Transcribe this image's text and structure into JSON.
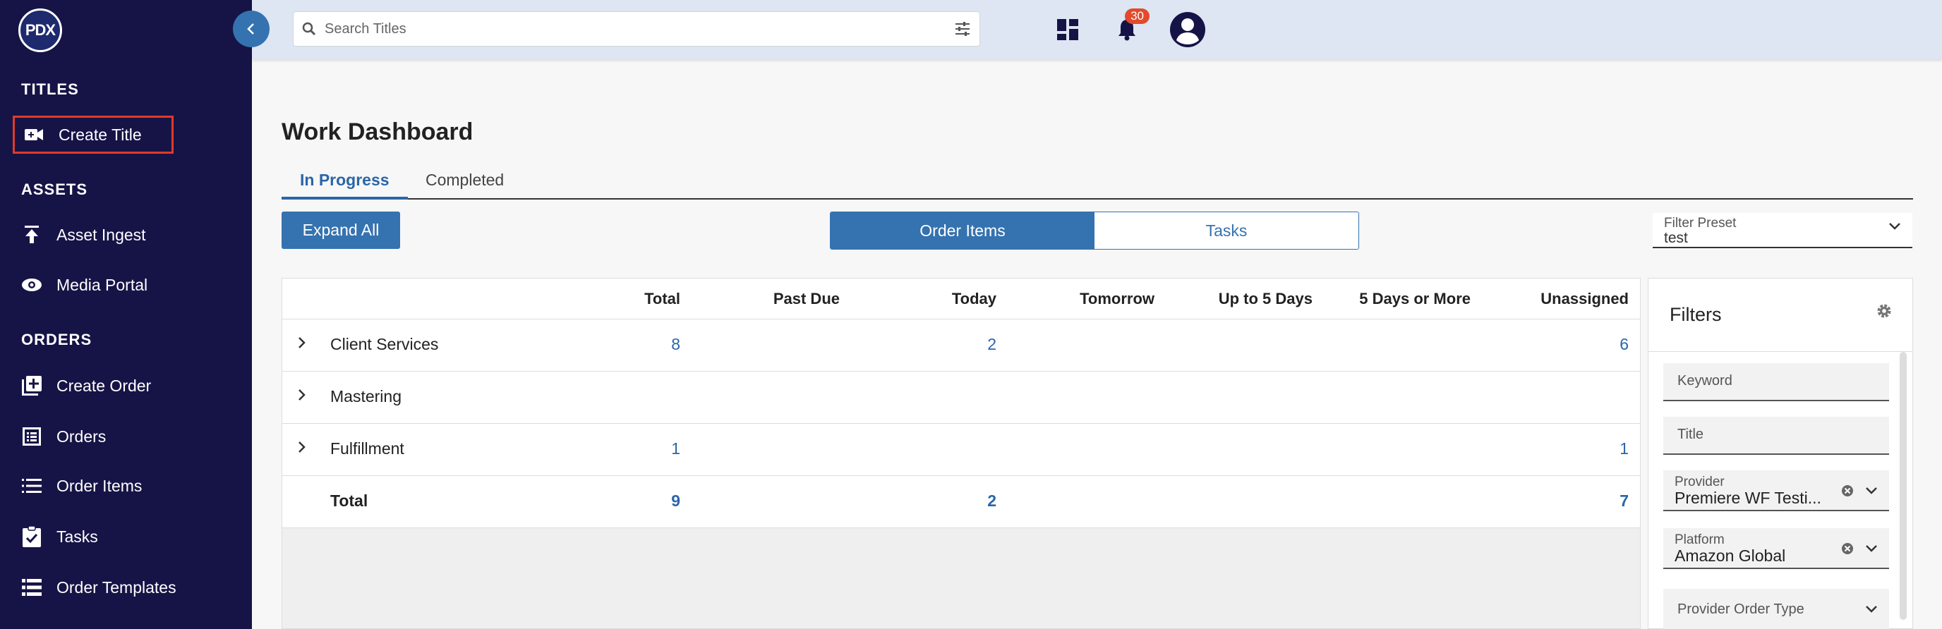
{
  "sidebar": {
    "logo_text": "PDX",
    "sections": [
      {
        "title": "TITLES"
      },
      {
        "title": "ASSETS"
      },
      {
        "title": "ORDERS"
      }
    ],
    "items": [
      {
        "label": "Create Title",
        "icon": "video-plus-icon"
      },
      {
        "label": "Asset Ingest",
        "icon": "upload-icon"
      },
      {
        "label": "Media Portal",
        "icon": "eye-icon"
      },
      {
        "label": "Create Order",
        "icon": "add-box-icon"
      },
      {
        "label": "Orders",
        "icon": "list-box-icon"
      },
      {
        "label": "Order Items",
        "icon": "list-icon"
      },
      {
        "label": "Tasks",
        "icon": "clipboard-check-icon"
      },
      {
        "label": "Order Templates",
        "icon": "table-list-icon"
      }
    ]
  },
  "topbar": {
    "search_placeholder": "Search Titles",
    "notification_count": "30"
  },
  "page": {
    "title": "Work Dashboard",
    "tabs": [
      {
        "label": "In Progress",
        "active": true
      },
      {
        "label": "Completed",
        "active": false
      }
    ],
    "expand_all_label": "Expand All",
    "toggle": {
      "order_items": "Order Items",
      "tasks": "Tasks"
    },
    "filter_preset": {
      "label": "Filter Preset",
      "value": "test"
    }
  },
  "table": {
    "columns": [
      "Total",
      "Past Due",
      "Today",
      "Tomorrow",
      "Up to 5 Days",
      "5 Days or More",
      "Unassigned"
    ],
    "rows": [
      {
        "name": "Client Services",
        "total": "8",
        "past_due": "",
        "today": "2",
        "tomorrow": "",
        "up_to_5": "",
        "five_or_more": "",
        "unassigned": "6"
      },
      {
        "name": "Mastering",
        "total": "",
        "past_due": "",
        "today": "",
        "tomorrow": "",
        "up_to_5": "",
        "five_or_more": "",
        "unassigned": ""
      },
      {
        "name": "Fulfillment",
        "total": "1",
        "past_due": "",
        "today": "",
        "tomorrow": "",
        "up_to_5": "",
        "five_or_more": "",
        "unassigned": "1"
      }
    ],
    "total_row": {
      "name": "Total",
      "total": "9",
      "past_due": "",
      "today": "2",
      "tomorrow": "",
      "up_to_5": "",
      "five_or_more": "",
      "unassigned": "7"
    }
  },
  "filters": {
    "title": "Filters",
    "keyword_placeholder": "Keyword",
    "title_placeholder": "Title",
    "provider": {
      "label": "Provider",
      "value": "Premiere WF Testi..."
    },
    "platform": {
      "label": "Platform",
      "value": "Amazon Global"
    },
    "provider_order_type_placeholder": "Provider Order Type"
  },
  "colors": {
    "sidebar_bg": "#161446",
    "accent": "#3572b0",
    "highlight_border": "#e03a2b",
    "badge": "#e24a2b"
  }
}
